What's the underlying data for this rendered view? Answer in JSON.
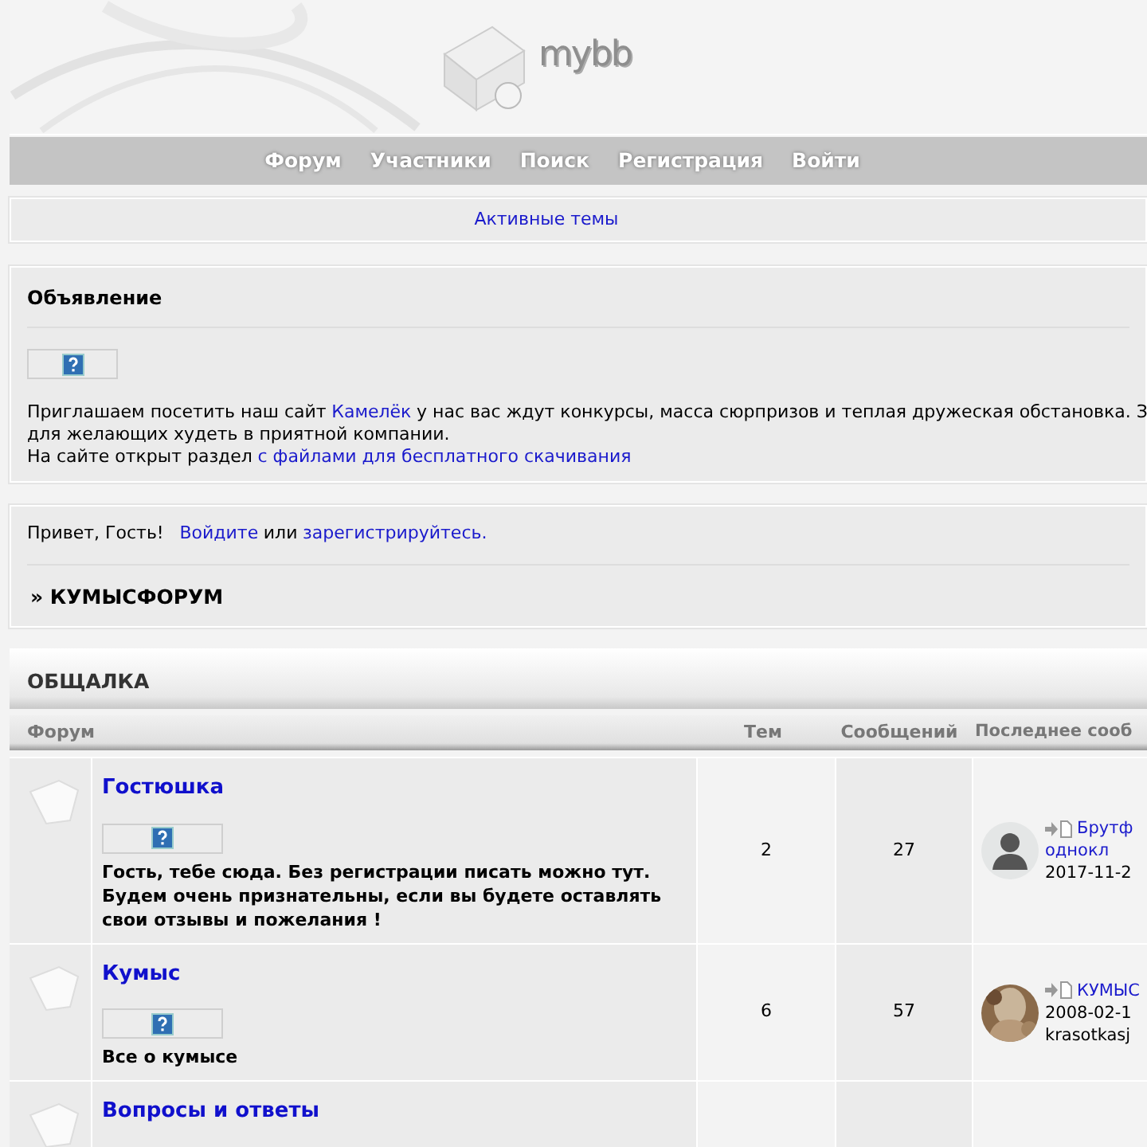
{
  "header": {
    "logo": "mybb"
  },
  "nav": [
    {
      "label": "Форум"
    },
    {
      "label": "Участники"
    },
    {
      "label": "Поиск"
    },
    {
      "label": "Регистрация"
    },
    {
      "label": "Войти"
    }
  ],
  "active_topics": "Активные темы",
  "announcement": {
    "title": "Объявление",
    "lines": [
      [
        {
          "kind": "text",
          "text": "Приглашаем посетить наш сайт"
        },
        {
          "kind": "link",
          "text": "Камелёк"
        },
        {
          "kind": "text",
          "text": "у нас вас ждут конкурсы, масса сюрпризов и теплая дружеская обстановка. З"
        }
      ],
      [
        {
          "kind": "text",
          "text": "для желающих худеть в приятной компании."
        }
      ],
      [
        {
          "kind": "text",
          "text": "На сайте открыт раздел"
        },
        {
          "kind": "link",
          "text": "с файлами для бесплатного скачивания"
        }
      ]
    ]
  },
  "welcome": [
    {
      "kind": "text",
      "text": "Привет, Гость!"
    },
    {
      "kind": "link",
      "text": "Войдите"
    },
    {
      "kind": "text",
      "text": "или"
    },
    {
      "kind": "link",
      "text": "зарегистрируйтесь."
    }
  ],
  "breadcrumb": "» КУМЫСФОРУМ",
  "category": {
    "title": "ОБЩАЛКА",
    "columns": [
      "Форум",
      "Тем",
      "Сообщений",
      "Последнее сооб"
    ],
    "forums": [
      {
        "name": "Гостюшка",
        "description": "Гость, тебе сюда. Без регистрации писать можно тут. Будем очень признательны, если вы будете оставлять свои отзывы и пожелания !",
        "topics": "2",
        "posts": "27",
        "last_post": {
          "avatar": {
            "kind": "silhouette"
          },
          "lines": [
            {
              "kind": "link",
              "text": "Брутф",
              "icon": true
            },
            {
              "kind": "link",
              "text": "однокл"
            },
            {
              "kind": "text",
              "text": "2017-11-2"
            }
          ]
        }
      },
      {
        "name": "Кумыс",
        "description": "Все о кумысе",
        "topics": "6",
        "posts": "57",
        "last_post": {
          "lines": [
            {
              "kind": "link",
              "text": "КУМЫС",
              "icon": true
            },
            {
              "kind": "text",
              "text": "2008-02-1"
            },
            {
              "kind": "text",
              "text": "krasotkasj"
            }
          ]
        }
      },
      {
        "name": "Вопросы и ответы"
      }
    ]
  }
}
